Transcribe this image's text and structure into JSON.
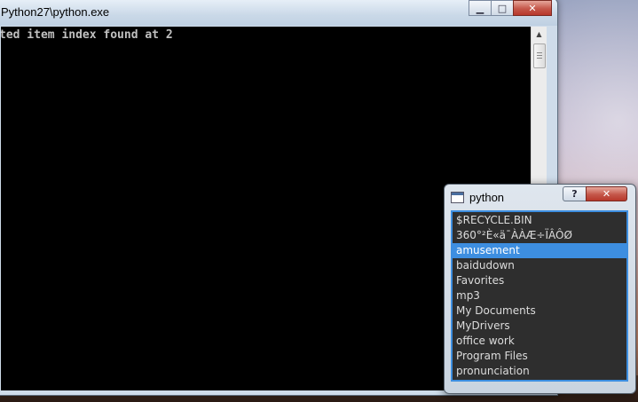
{
  "console": {
    "title": "Python27\\python.exe",
    "output": "ted item index found at 2",
    "controls": {
      "minimize": "▁",
      "maximize": "□",
      "close": "✕"
    },
    "scroll": {
      "up": "▲",
      "down": "▼"
    }
  },
  "dialog": {
    "title": "python",
    "help_label": "?",
    "close_label": "✕",
    "selected_index": 2,
    "items": [
      "$RECYCLE.BIN",
      "360°²È«ä¯ÀÀÆ÷ÏÂÔØ",
      "amusement",
      "baidudown",
      "Favorites",
      "mp3",
      "My Documents",
      "MyDrivers",
      "office work",
      "Program Files",
      "pronunciation"
    ]
  },
  "colors": {
    "selection": "#3d8ee0",
    "console_bg": "#000000",
    "list_bg": "#2e2e2e"
  }
}
